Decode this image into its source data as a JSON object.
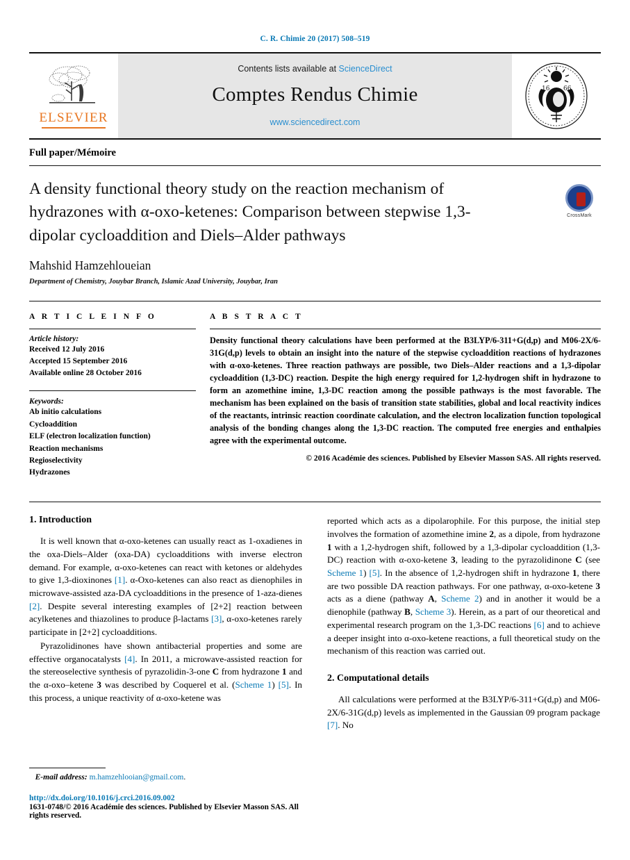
{
  "running_head": "C. R. Chimie 20 (2017) 508–519",
  "masthead": {
    "contents_prefix": "Contents lists available at",
    "sciencedirect": "ScienceDirect",
    "journal_name": "Comptes Rendus Chimie",
    "journal_url": "www.sciencedirect.com",
    "publisher_wordmark": "ELSEVIER",
    "seal_alt": "Institut de France — Académie des sciences 1666"
  },
  "article_type": "Full paper/Mémoire",
  "title": "A density functional theory study on the reaction mechanism of hydrazones with α-oxo-ketenes: Comparison between stepwise 1,3-dipolar cycloaddition and Diels–Alder pathways",
  "crossmark_label": "CrossMark",
  "author": "Mahshid Hamzehloueian",
  "affiliation": "Department of Chemistry, Jouybar Branch, Islamic Azad University, Jouybar, Iran",
  "article_info": {
    "heading": "A R T I C L E   I N F O",
    "history_label": "Article history:",
    "history": [
      "Received 12 July 2016",
      "Accepted 15 September 2016",
      "Available online 28 October 2016"
    ],
    "keywords_label": "Keywords:",
    "keywords": [
      "Ab initio calculations",
      "Cycloaddition",
      "ELF (electron localization function)",
      "Reaction mechanisms",
      "Regioselectivity",
      "Hydrazones"
    ]
  },
  "abstract": {
    "heading": "A B S T R A C T",
    "text": "Density functional theory calculations have been performed at the B3LYP/6-311+G(d,p) and M06-2X/6-31G(d,p) levels to obtain an insight into the nature of the stepwise cycloaddition reactions of hydrazones with α-oxo-ketenes. Three reaction pathways are possible, two Diels–Alder reactions and a 1,3-dipolar cycloaddition (1,3-DC) reaction. Despite the high energy required for 1,2-hydrogen shift in hydrazone to form an azomethine imine, 1,3-DC reaction among the possible pathways is the most favorable. The mechanism has been explained on the basis of transition state stabilities, global and local reactivity indices of the reactants, intrinsic reaction coordinate calculation, and the electron localization function topological analysis of the bonding changes along the 1,3-DC reaction. The computed free energies and enthalpies agree with the experimental outcome.",
    "copyright": "© 2016 Académie des sciences. Published by Elsevier Masson SAS. All rights reserved."
  },
  "sections": {
    "introduction_heading": "1.  Introduction",
    "computational_heading": "2.  Computational details"
  },
  "body": {
    "intro_p1_a": "It is well known that α-oxo-ketenes can usually react as 1-oxadienes in the oxa-Diels–Alder (oxa-DA) cycloadditions with inverse electron demand. For example, α-oxo-ketenes can react with ketones or aldehydes to give 1,3-dioxinones ",
    "ref1": "[1]",
    "intro_p1_b": ". α-Oxo-ketenes can also react as dienophiles in microwave-assisted aza-DA cycloadditions in the presence of 1-aza-dienes ",
    "ref2": "[2]",
    "intro_p1_c": ". Despite several interesting examples of [2+2] reaction between acylketenes and thiazolines to produce β-lactams ",
    "ref3": "[3]",
    "intro_p1_d": ", α-oxo-ketenes rarely participate in [2+2] cycloadditions.",
    "intro_p2_a": "Pyrazolidinones have shown antibacterial properties and some are effective organocatalysts ",
    "ref4": "[4]",
    "intro_p2_b": ". In 2011, a microwave-assisted reaction for the stereoselective synthesis of pyrazolidin-3-one ",
    "bold_C": "C",
    "intro_p2_c": " from hydrazone ",
    "bold_1": "1",
    "intro_p2_d": " and the α-oxo–ketene ",
    "bold_3": "3",
    "intro_p2_e": " was described by Coquerel et al. (",
    "scheme1": "Scheme 1",
    "intro_p2_f": ") ",
    "ref5": "[5]",
    "intro_p2_g": ". In this process, a unique reactivity of α-oxo-ketene was",
    "right_p1_a": "reported which acts as a dipolarophile. For this purpose, the initial step involves the formation of azomethine imine ",
    "bold_2": "2",
    "right_p1_b": ", as a dipole, from hydrazone ",
    "right_p1_c": " with a 1,2-hydrogen shift, followed by a 1,3-dipolar cycloaddition (1,3-DC) reaction with α-oxo-ketene ",
    "right_p1_d": ", leading to the pyrazolidinone ",
    "right_p1_e": " (see ",
    "right_p1_f": ") ",
    "right_p1_g": ". In the absence of 1,2-hydrogen shift in hydrazone ",
    "right_p1_h": ", there are two possible DA reaction pathways. For one pathway, α-oxo-ketene ",
    "right_p1_i": " acts as a diene (pathway ",
    "bold_A": "A",
    "right_p1_j": ", ",
    "scheme2": "Scheme 2",
    "right_p1_k": ") and in another it would be a dienophile (pathway ",
    "bold_B": "B",
    "scheme3": "Scheme 3",
    "right_p1_l": "). Herein, as a part of our theoretical and experimental research program on the 1,3-DC reactions ",
    "ref6": "[6]",
    "right_p1_m": " and to achieve a deeper insight into α-oxo-ketene reactions, a full theoretical study on the mechanism of this reaction was carried out.",
    "comp_p1_a": "All calculations were performed at the B3LYP/6-311+G(d,p) and M06-2X/6-31G(d,p) levels as implemented in the Gaussian 09 program package ",
    "ref7": "[7]",
    "comp_p1_b": ". No"
  },
  "footer": {
    "email_label": "E-mail address:",
    "email": "m.hamzehlooian@gmail.com",
    "email_period": ".",
    "doi": "http://dx.doi.org/10.1016/j.crci.2016.09.002",
    "issn_line": "1631-0748/© 2016 Académie des sciences. Published by Elsevier Masson SAS. All rights reserved."
  },
  "colors": {
    "link": "#0b7ab5",
    "sciencedirect": "#2a8fd0",
    "elsevier_orange": "#e87722",
    "panel_bg": "#e6e6e6"
  }
}
